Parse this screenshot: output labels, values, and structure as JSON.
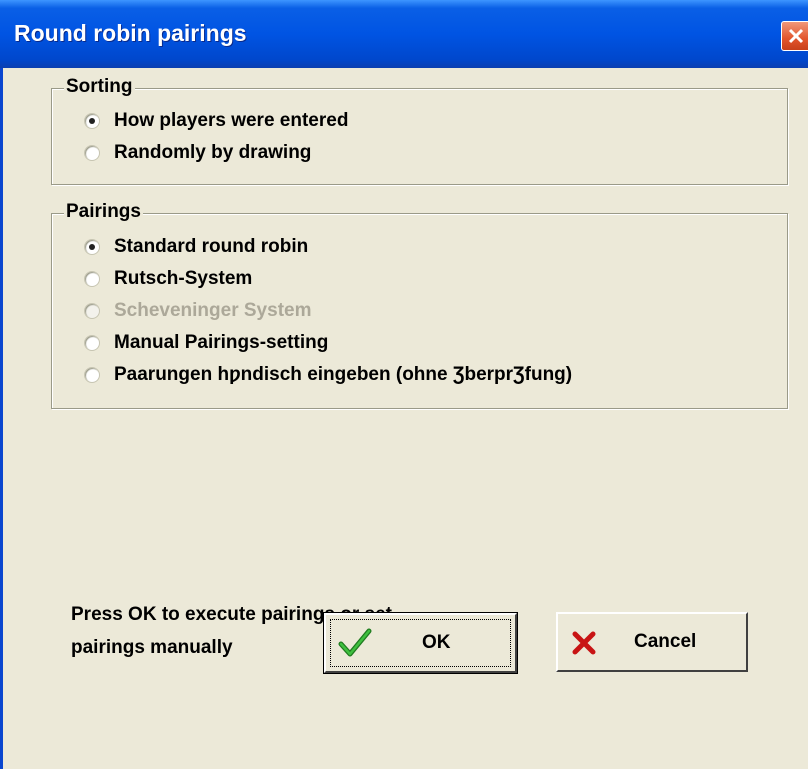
{
  "window": {
    "title": "Round robin pairings"
  },
  "sorting": {
    "legend": "Sorting",
    "options": [
      {
        "label": "How players were entered",
        "checked": true,
        "enabled": true
      },
      {
        "label": "Randomly by drawing",
        "checked": false,
        "enabled": true
      }
    ]
  },
  "pairings": {
    "legend": "Pairings",
    "options": [
      {
        "label": "Standard round robin",
        "checked": true,
        "enabled": true
      },
      {
        "label": "Rutsch-System",
        "checked": false,
        "enabled": true
      },
      {
        "label": "Scheveninger System",
        "checked": false,
        "enabled": false
      },
      {
        "label": "Manual Pairings-setting",
        "checked": false,
        "enabled": true
      },
      {
        "label": "Paarungen hƿndisch eingeben (ohne ƷberprƷfung)",
        "checked": false,
        "enabled": true
      }
    ]
  },
  "info": {
    "text_line1": "Press OK to execute pairings or set",
    "text_line2": "pairings manually"
  },
  "buttons": {
    "ok_label": "OK",
    "ok_icon": "check-icon",
    "cancel_label": "Cancel",
    "cancel_icon": "x-icon"
  },
  "colors": {
    "titlebar": "#0054e3",
    "face": "#ece9d8",
    "check_green": "#2e9b2e",
    "cancel_red": "#c81414",
    "close_red": "#e2552c"
  }
}
